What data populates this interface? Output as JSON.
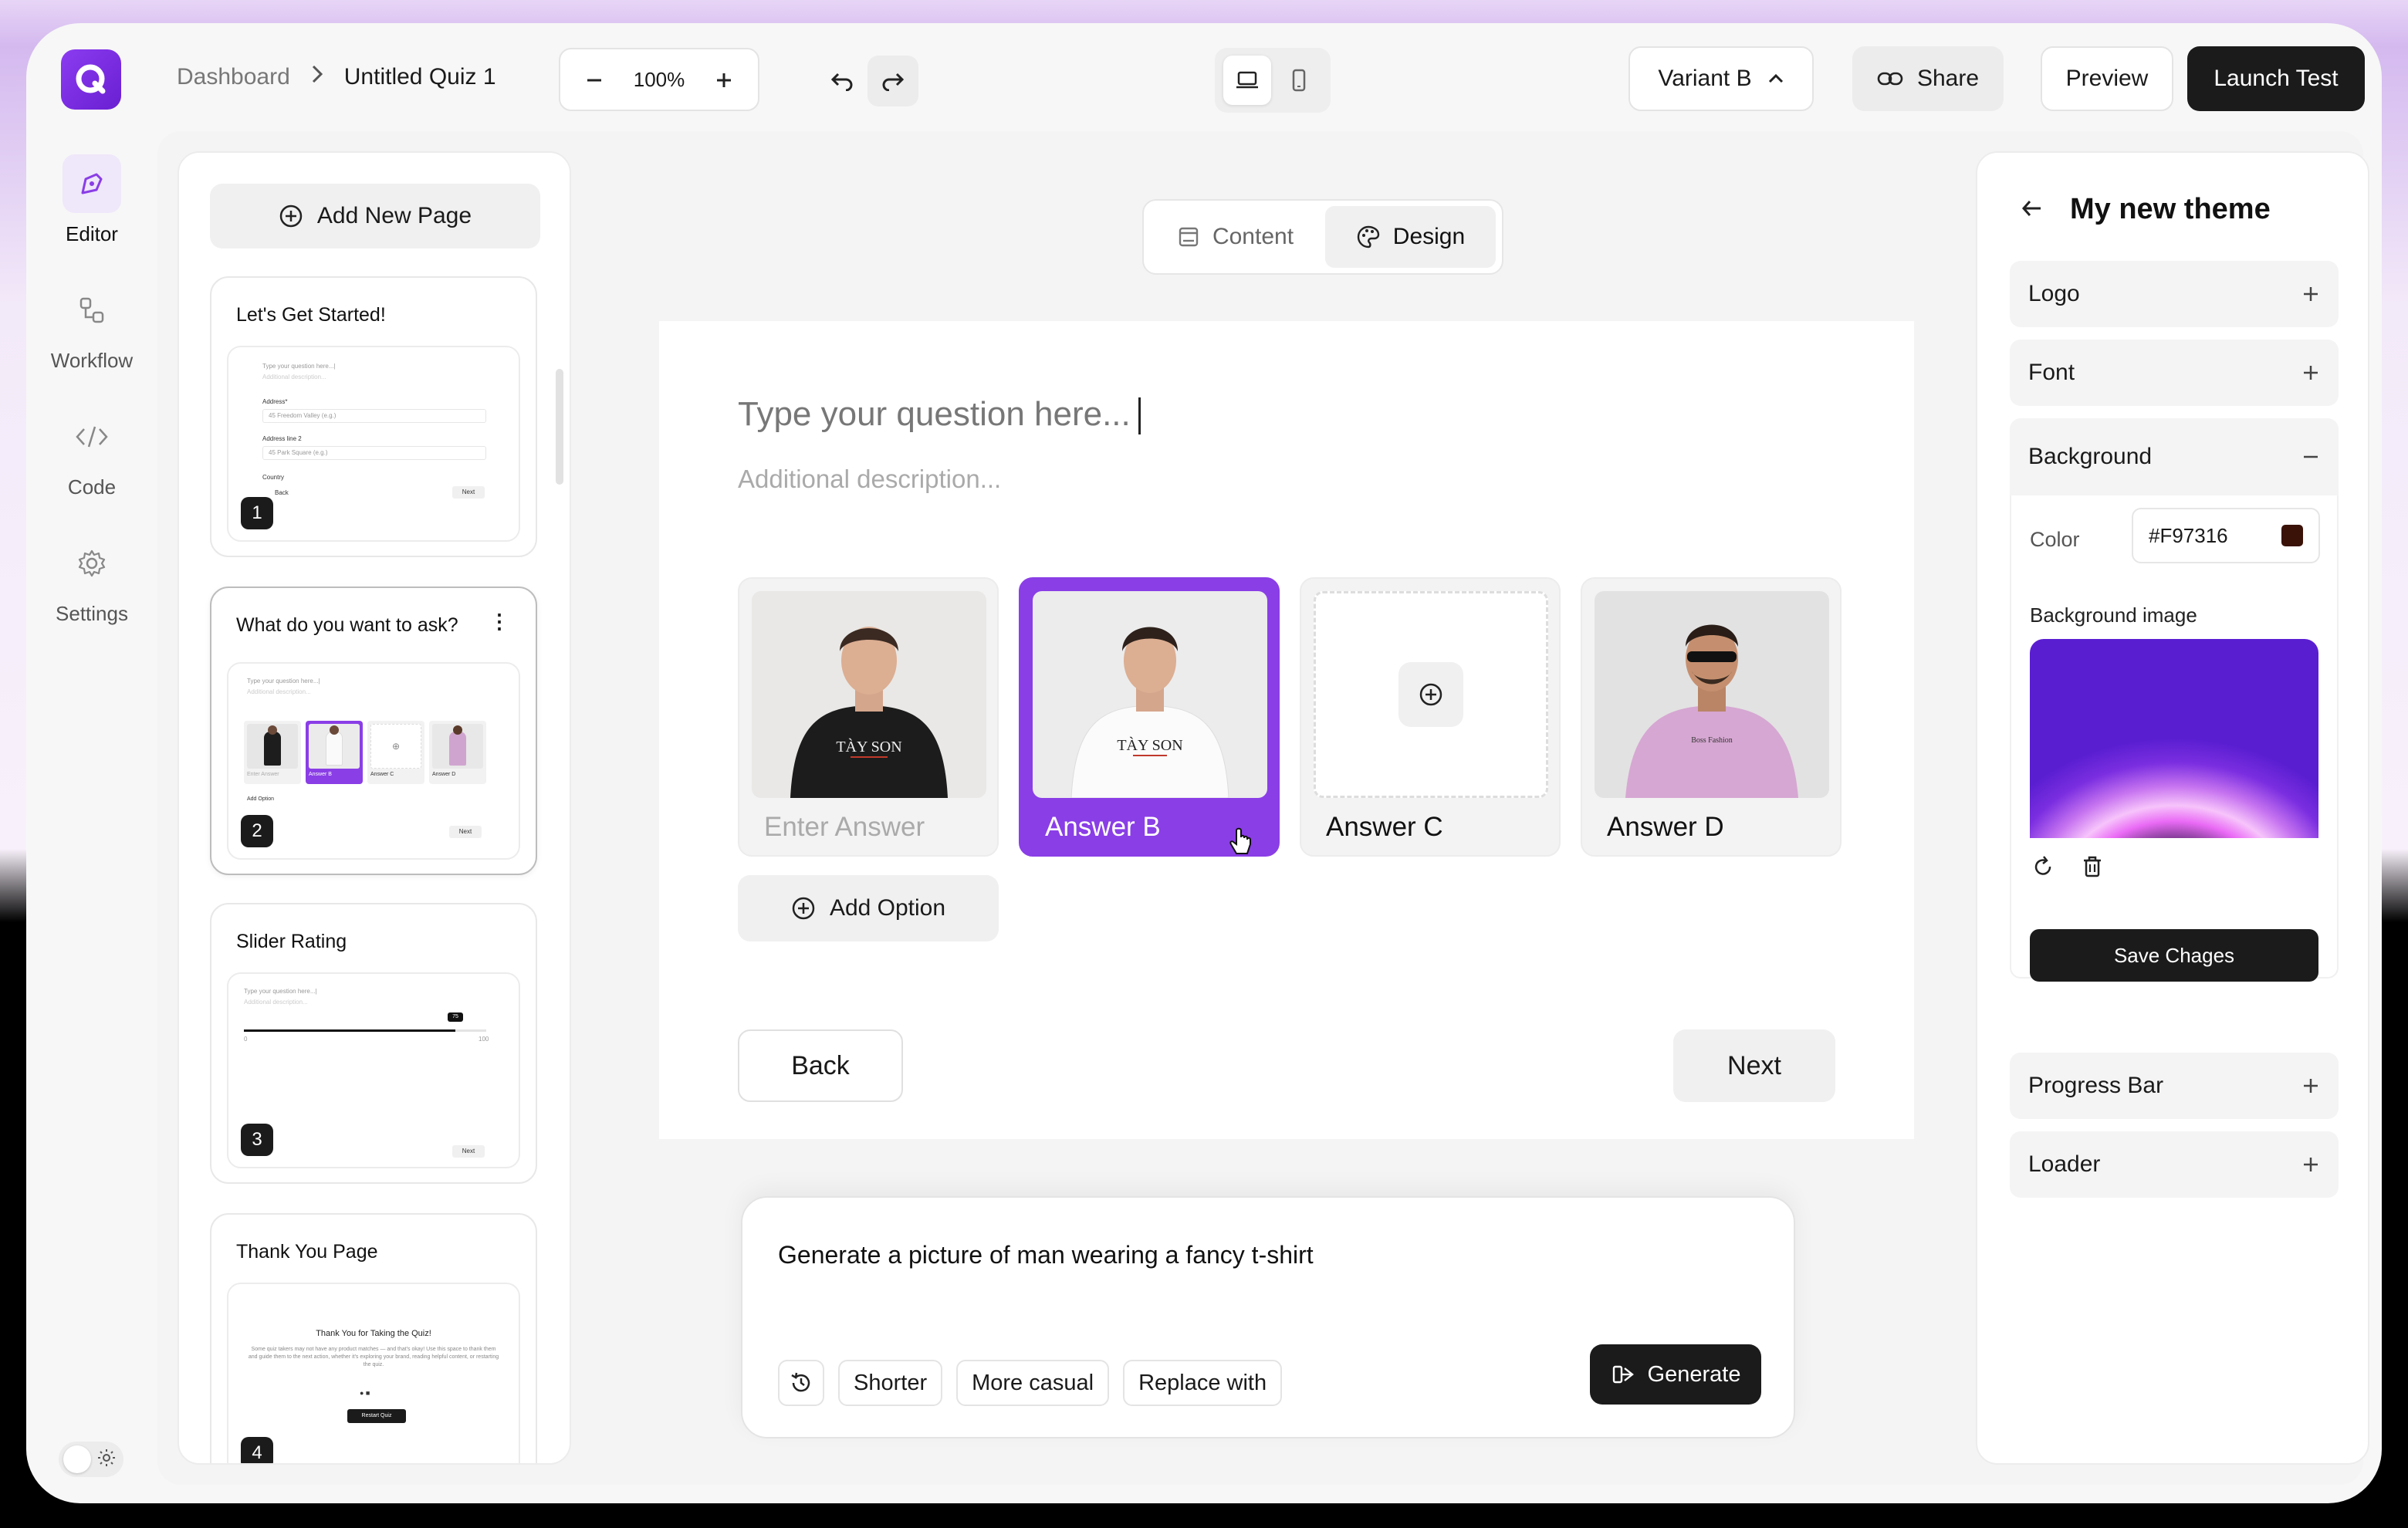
{
  "topbar": {
    "breadcrumb_root": "Dashboard",
    "breadcrumb_current": "Untitled Quiz 1",
    "zoom": "100%",
    "variant": "Variant B",
    "share": "Share",
    "preview": "Preview",
    "launch": "Launch Test"
  },
  "rail": {
    "editor": "Editor",
    "workflow": "Workflow",
    "code": "Code",
    "settings": "Settings"
  },
  "pages": {
    "add_label": "Add New Page",
    "items": [
      {
        "title": "Let's Get Started!",
        "num": "1"
      },
      {
        "title": "What do you want to ask?",
        "num": "2"
      },
      {
        "title": "Slider Rating",
        "num": "3"
      },
      {
        "title": "Thank You Page",
        "num": "4"
      }
    ],
    "thumb1": {
      "q": "Type your question here...|",
      "d": "Additional description...",
      "addr": "Address*",
      "addr_ph": "45 Freedom Valley (e.g.)",
      "addr2": "Address line 2",
      "addr2_ph": "45 Park Square (e.g.)",
      "country": "Country",
      "back": "Back",
      "next": "Next"
    },
    "thumb2": {
      "q": "Type your question here...|",
      "d": "Additional description...",
      "a1": "Enter Answer",
      "a2": "Answer B",
      "a3": "Answer C",
      "a4": "Answer D",
      "add": "Add Option",
      "next": "Next"
    },
    "thumb3": {
      "q": "Type your question here...|",
      "d": "Additional description...",
      "min": "0",
      "max": "100",
      "val": "75",
      "next": "Next"
    },
    "thumb4": {
      "title": "Thank You for Taking the Quiz!",
      "body": "Some quiz takers may not have any product matches — and that's okay! Use this space to thank them and guide them to the next action, whether it's exploring your brand, reading helpful content, or restarting the quiz.",
      "btn": "Restart Quiz"
    }
  },
  "tabs": {
    "content": "Content",
    "design": "Design"
  },
  "question": {
    "title": "Type your question here...",
    "description": "Additional description...",
    "answers": [
      {
        "label": "Enter Answer",
        "placeholder": true
      },
      {
        "label": "Answer B",
        "selected": true
      },
      {
        "label": "Answer C"
      },
      {
        "label": "Answer D"
      }
    ],
    "add_option": "Add Option",
    "back": "Back",
    "next": "Next"
  },
  "prompt": {
    "text": "Generate a picture of man wearing a fancy t-shirt",
    "chips": [
      "Shorter",
      "More casual",
      "Replace with"
    ],
    "generate": "Generate"
  },
  "theme": {
    "title": "My new theme",
    "logo": "Logo",
    "font": "Font",
    "background": "Background",
    "color_label": "Color",
    "color_value": "#F97316",
    "swatch": "#3a1208",
    "bg_image_label": "Background image",
    "save": "Save Chages",
    "progress": "Progress Bar",
    "loader": "Loader"
  },
  "colors": {
    "accent": "#8a3ee6",
    "dark": "#1b1b1b"
  },
  "icons": [
    "logo-q-icon",
    "chevron-right-icon",
    "minus-icon",
    "plus-icon",
    "undo-icon",
    "redo-icon",
    "laptop-icon",
    "mobile-icon",
    "chevron-up-icon",
    "link-icon",
    "pen-tool-icon",
    "workflow-icon",
    "code-icon",
    "gear-icon",
    "sun-icon",
    "plus-circle-icon",
    "kebab-icon",
    "layout-icon",
    "palette-icon",
    "cursor-icon",
    "history-icon",
    "generate-icon",
    "arrow-left-icon",
    "refresh-icon",
    "trash-icon"
  ]
}
